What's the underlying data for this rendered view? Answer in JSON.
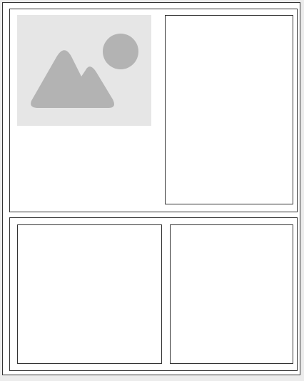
{
  "colors": {
    "background": "#ececec",
    "page": "#ffffff",
    "border": "#333333",
    "placeholder_bg": "#e6e6e6",
    "placeholder_shape": "#b3b3b3"
  },
  "icons": {
    "image_placeholder": "image-placeholder-icon"
  }
}
